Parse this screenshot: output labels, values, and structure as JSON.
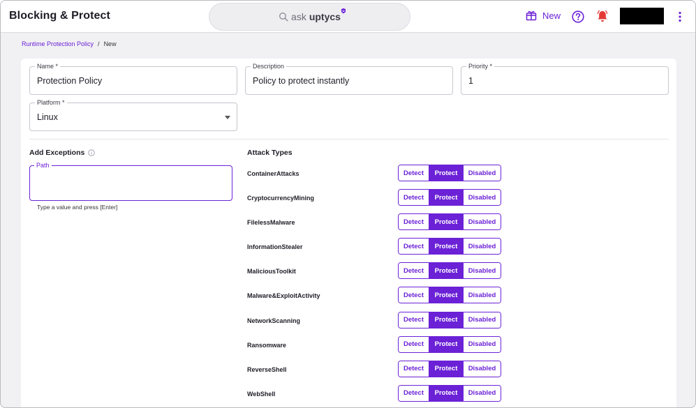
{
  "header": {
    "title": "Blocking & Protect",
    "ask": {
      "prefix": "ask",
      "brand": "uptycs"
    },
    "new_label": "New"
  },
  "breadcrumb": {
    "parent": "Runtime Protection Policy",
    "separator": "/",
    "current": "New"
  },
  "form": {
    "name": {
      "label": "Name *",
      "value": "Protection Policy"
    },
    "description": {
      "label": "Description",
      "value": "Policy to protect instantly"
    },
    "priority": {
      "label": "Priority *",
      "value": "1"
    },
    "platform": {
      "label": "Platform *",
      "value": "Linux"
    }
  },
  "exceptions": {
    "title": "Add Exceptions",
    "path_label": "Path",
    "path_value": "",
    "helper": "Type a value and press [Enter]"
  },
  "attack_types": {
    "title": "Attack Types",
    "options": [
      "Detect",
      "Protect",
      "Disabled"
    ],
    "items": [
      {
        "name": "ContainerAttacks",
        "selected": "Protect"
      },
      {
        "name": "CryptocurrencyMining",
        "selected": "Protect"
      },
      {
        "name": "FilelessMalware",
        "selected": "Protect"
      },
      {
        "name": "InformationStealer",
        "selected": "Protect"
      },
      {
        "name": "MaliciousToolkit",
        "selected": "Protect"
      },
      {
        "name": "Malware&ExploitActivity",
        "selected": "Protect"
      },
      {
        "name": "NetworkScanning",
        "selected": "Protect"
      },
      {
        "name": "Ransomware",
        "selected": "Protect"
      },
      {
        "name": "ReverseShell",
        "selected": "Protect"
      },
      {
        "name": "WebShell",
        "selected": "Protect"
      }
    ]
  },
  "colors": {
    "accent": "#6b21d6",
    "alert": "#e53935"
  }
}
